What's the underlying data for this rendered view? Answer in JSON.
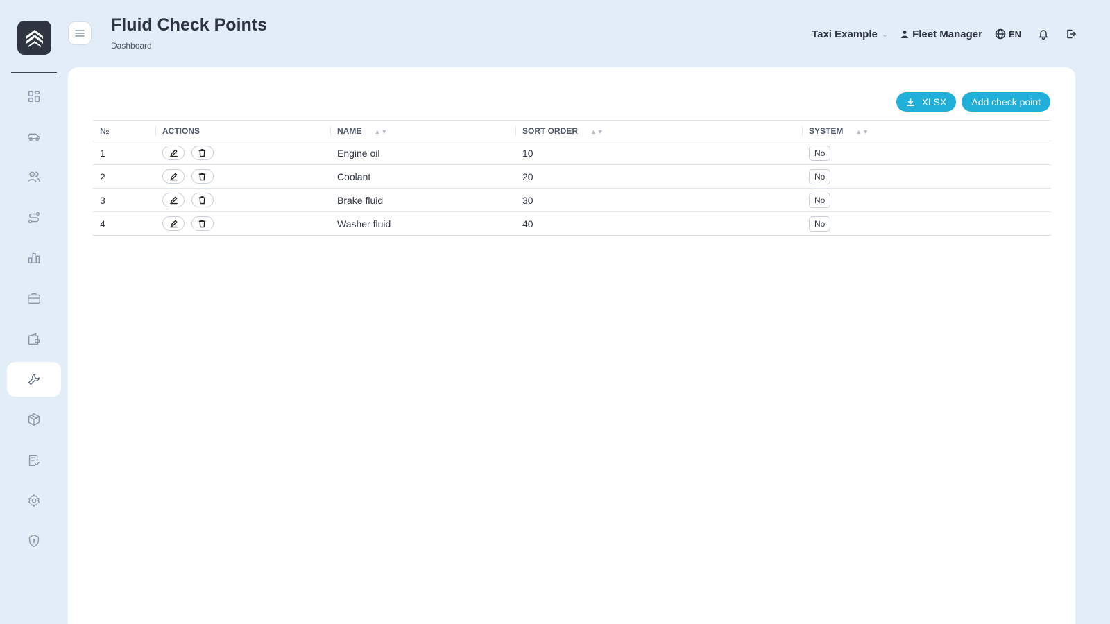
{
  "header": {
    "title": "Fluid Check Points",
    "breadcrumb": "Dashboard",
    "company": "Taxi Example",
    "user": "Fleet Manager",
    "language": "EN"
  },
  "sidebar": {
    "items": [
      {
        "icon": "dashboard-icon",
        "active": false
      },
      {
        "icon": "car-icon",
        "active": false
      },
      {
        "icon": "users-icon",
        "active": false
      },
      {
        "icon": "route-icon",
        "active": false
      },
      {
        "icon": "chart-icon",
        "active": false
      },
      {
        "icon": "briefcase-icon",
        "active": false
      },
      {
        "icon": "wallet-icon",
        "active": false
      },
      {
        "icon": "wrench-icon",
        "active": true
      },
      {
        "icon": "box-icon",
        "active": false
      },
      {
        "icon": "checklist-icon",
        "active": false
      },
      {
        "icon": "gear-icon",
        "active": false
      },
      {
        "icon": "shield-icon",
        "active": false
      }
    ]
  },
  "toolbar": {
    "export_label": "XLSX",
    "add_label": "Add check point"
  },
  "table": {
    "columns": [
      "№",
      "ACTIONS",
      "NAME",
      "SORT ORDER",
      "SYSTEM"
    ],
    "sort_glyph": "▲▼",
    "rows": [
      {
        "num": "1",
        "name": "Engine oil",
        "sort_order": "10",
        "system": "No"
      },
      {
        "num": "2",
        "name": "Coolant",
        "sort_order": "20",
        "system": "No"
      },
      {
        "num": "3",
        "name": "Brake fluid",
        "sort_order": "30",
        "system": "No"
      },
      {
        "num": "4",
        "name": "Washer fluid",
        "sort_order": "40",
        "system": "No"
      }
    ]
  },
  "colors": {
    "background": "#e3edf7",
    "accent": "#1fafd8",
    "logo_bg": "#2f3642",
    "text": "#2d3440"
  }
}
